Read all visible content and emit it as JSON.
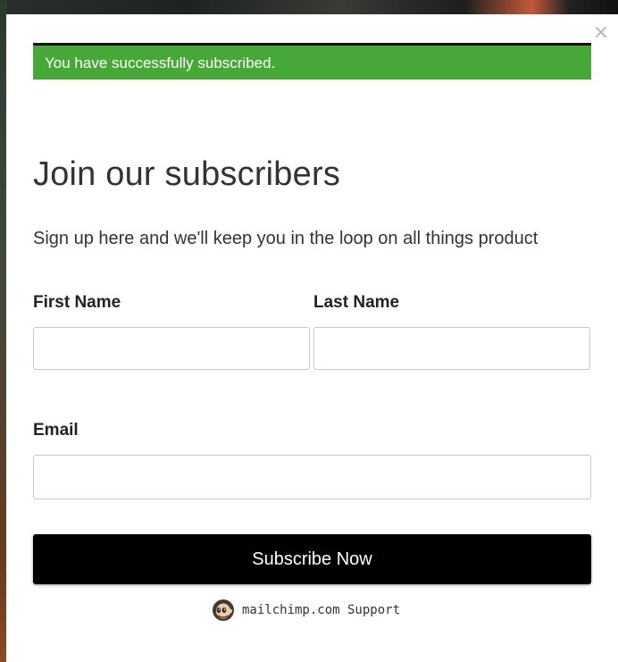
{
  "notice": {
    "success_text": "You have successfully subscribed.",
    "success_color": "#46a836"
  },
  "modal": {
    "close_glyph": "×"
  },
  "form": {
    "title": "Join our subscribers",
    "subtitle": "Sign up here and we'll keep you in the loop on all things product",
    "first_name_label": "First Name",
    "first_name_value": "",
    "last_name_label": "Last Name",
    "last_name_value": "",
    "email_label": "Email",
    "email_value": "",
    "submit_label": "Subscribe Now",
    "submit_color": "#000000"
  },
  "footer": {
    "icon": "mailchimp-logo-icon",
    "support_text": "mailchimp.com Support"
  }
}
